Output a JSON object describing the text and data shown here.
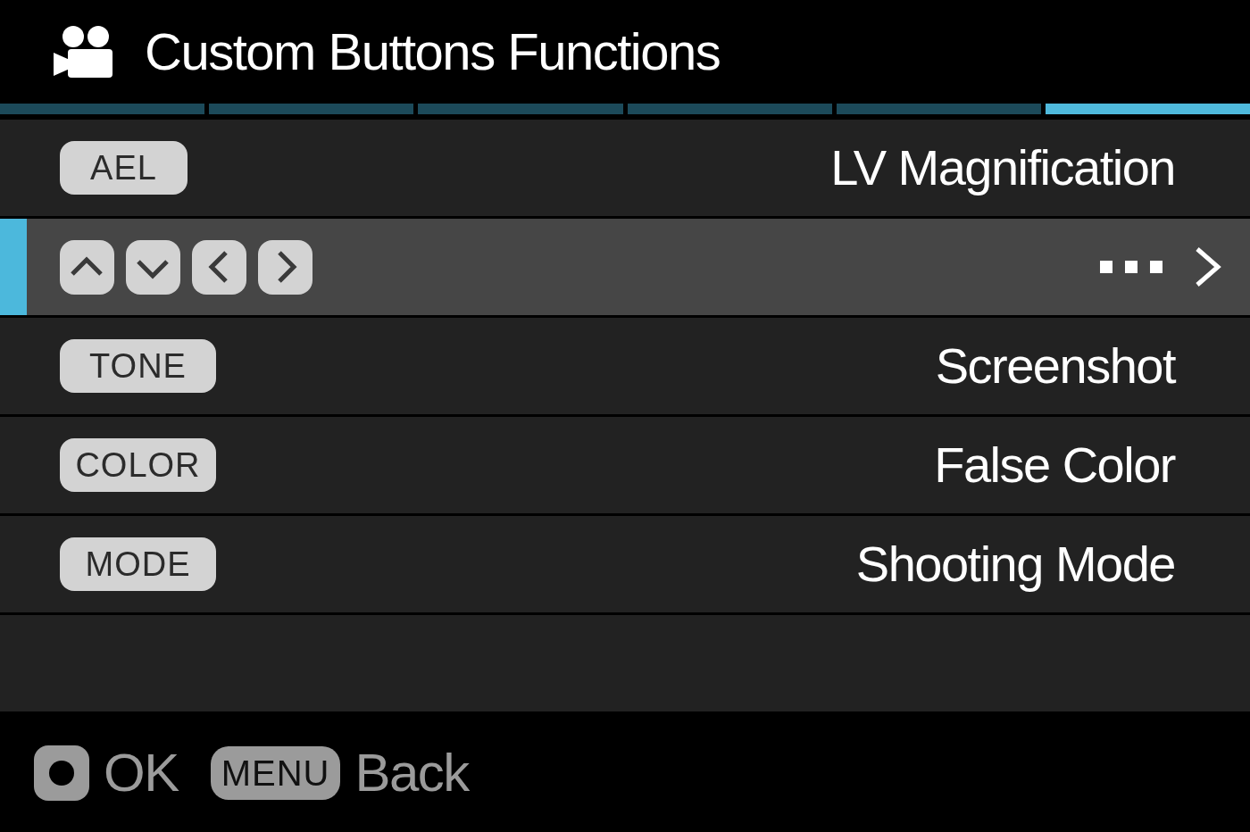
{
  "header": {
    "title": "Custom Buttons Functions"
  },
  "pages": [
    {
      "selected": false
    },
    {
      "selected": false
    },
    {
      "selected": false
    },
    {
      "selected": false
    },
    {
      "selected": false
    },
    {
      "selected": true
    }
  ],
  "rows": [
    {
      "kind": "key",
      "key": "AEL",
      "value": "LV Magnification",
      "selected": false
    },
    {
      "kind": "dpad",
      "selected": true
    },
    {
      "kind": "key",
      "key": "TONE",
      "value": "Screenshot",
      "selected": false
    },
    {
      "kind": "key",
      "key": "COLOR",
      "value": "False Color",
      "selected": false
    },
    {
      "kind": "key",
      "key": "MODE",
      "value": "Shooting Mode",
      "selected": false
    }
  ],
  "footer": {
    "hints": [
      {
        "kind": "ok",
        "label": "OK"
      },
      {
        "kind": "key",
        "key": "MENU",
        "label": "Back"
      }
    ]
  }
}
